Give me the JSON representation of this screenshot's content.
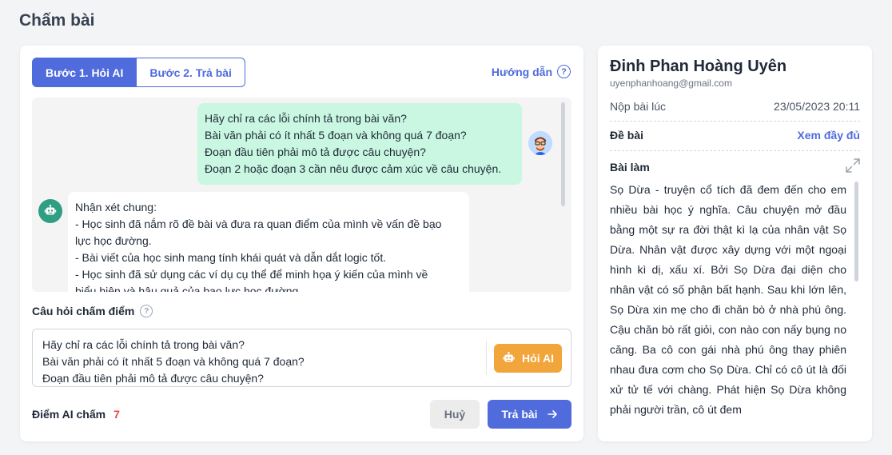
{
  "page": {
    "title": "Chấm bài"
  },
  "tabs": [
    {
      "label": "Bước 1. Hỏi AI",
      "active": true
    },
    {
      "label": "Bước 2. Trả bài",
      "active": false
    }
  ],
  "guide": {
    "label": "Hướng dẫn",
    "icon": "question-circle-icon"
  },
  "chat": {
    "user_message": [
      "Hãy chỉ ra các lỗi chính tả trong bài văn?",
      "Bài văn phải có ít nhất 5 đoạn và không quá 7 đoạn?",
      "Đoạn đầu tiên phải mô tả được câu chuyện?",
      "Đoạn 2 hoặc đoạn 3 cần nêu được cảm xúc về câu chuyện."
    ],
    "ai_message": [
      "Nhận xét chung:",
      "- Học sinh đã nắm rõ đề bài và đưa ra quan điểm của mình về vấn đề bạo",
      "lực học đường.",
      "- Bài viết của học sinh mang tính khái quát và dẫn dắt logic tốt.",
      "- Học sinh đã sử dụng các ví dụ cụ thể để minh họa ý kiến của mình về",
      "biểu hiện và hậu quả của bạo lực học đường."
    ]
  },
  "question": {
    "label": "Câu hỏi chấm điểm",
    "lines": [
      "Hãy chỉ ra các lỗi chính tả trong bài văn?",
      "Bài văn phải có ít nhất 5 đoạn và không quá 7 đoạn?",
      "Đoạn đầu tiên phải mô tả được câu chuyện?"
    ],
    "ask_button": "Hỏi AI"
  },
  "footer": {
    "score_label": "Điểm AI chấm",
    "score_value": "7",
    "cancel_label": "Huỷ",
    "return_label": "Trả bài"
  },
  "student": {
    "name": "Đinh Phan Hoàng Uyên",
    "email": "uyenphanhoang@gmail.com",
    "submitted_label": "Nộp bài lúc",
    "submitted_at": "23/05/2023 20:11",
    "topic_label": "Đề bài",
    "topic_link": "Xem đầy đủ",
    "work_label": "Bài làm",
    "essay": "Sọ Dừa - truyện cổ tích đã đem đến cho em nhiều bài học ý nghĩa. Câu chuyện mở đầu bằng một sự ra đời thật kì lạ của nhân vật Sọ Dừa. Nhân vật được xây dựng với một ngoại hình kì dị, xấu xí. Bởi Sọ Dừa đại diện cho nhân vật có số phận bất hạnh. Sau khi lớn lên, Sọ Dừa xin mẹ cho đi chăn bò ở nhà phú ông. Cậu chăn bò rất giỏi, con nào con nấy bụng no căng. Ba cô con gái nhà phú ông thay phiên nhau đưa cơm cho Sọ Dừa. Chỉ có cô út là đối xử tử tế với chàng. Phát hiện Sọ Dừa không phải người trần, cô út đem"
  },
  "colors": {
    "primary": "#4f6bdc",
    "accent": "#f2a53a",
    "user_bubble": "#c9f7e1",
    "ai_avatar": "#2f9e83",
    "score": "#ef4444"
  }
}
